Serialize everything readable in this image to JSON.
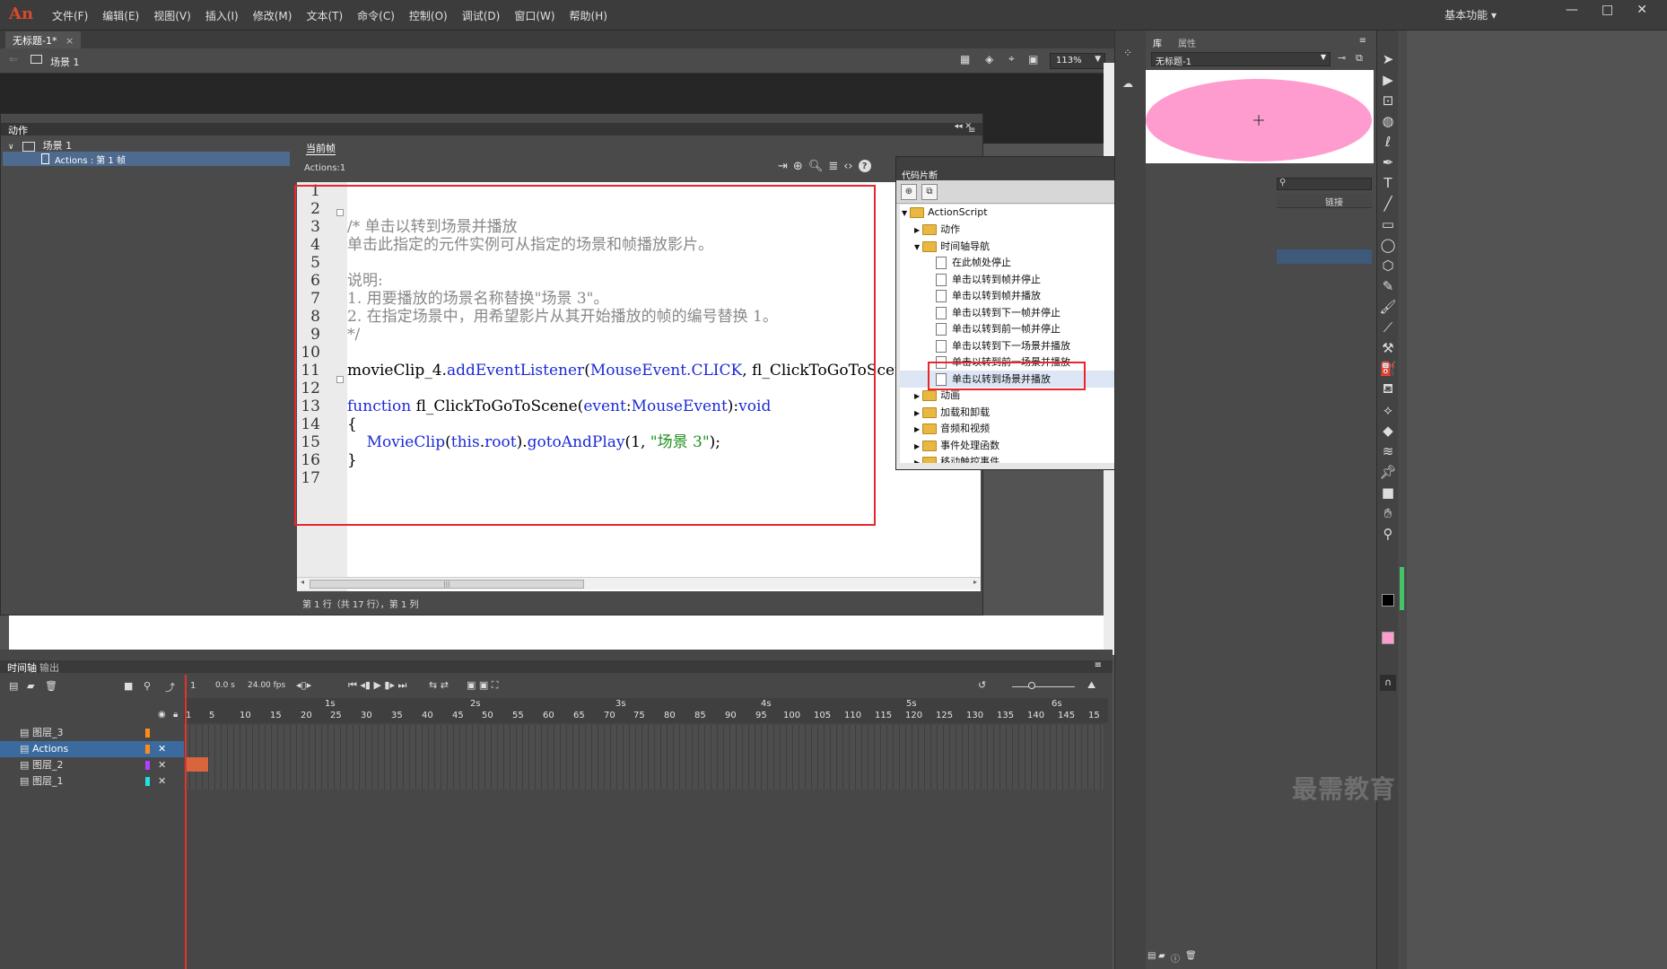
{
  "menubar": {
    "logo": "An",
    "items": [
      "文件(F)",
      "编辑(E)",
      "视图(V)",
      "插入(I)",
      "修改(M)",
      "文本(T)",
      "命令(C)",
      "控制(O)",
      "调试(D)",
      "窗口(W)",
      "帮助(H)"
    ],
    "workspace": "基本功能 ▾",
    "win_controls": [
      "—",
      "□",
      "✕"
    ]
  },
  "document": {
    "tab_label": "无标题-1*",
    "tab_close": "×",
    "scene_label": "场景 1",
    "zoom": "113%"
  },
  "actions_panel": {
    "title": "动作",
    "tree_scene": "场景 1",
    "tree_frame": "Actions : 第 1 帧",
    "tab_current": "当前帧",
    "script_name": "Actions:1",
    "line_numbers": [
      "1",
      "2",
      "3",
      "4",
      "5",
      "6",
      "7",
      "8",
      "9",
      "10",
      "11",
      "12",
      "13",
      "14",
      "15",
      "16",
      "17"
    ],
    "status": "第 1 行（共 17 行），第 1 列",
    "scroll_marker": "|||"
  },
  "code": {
    "line3": "/* 单击以转到场景并播放",
    "line4": "单击此指定的元件实例可从指定的场景和帧播放影片。",
    "line6": "说明:",
    "line7": "1. 用要播放的场景名称替换\"场景 3\"。",
    "line8": "2. 在指定场景中，用希望影片从其开始播放的帧的编号替换 1。",
    "line9": "*/",
    "line11_a": "movieClip_4.",
    "line11_b": "addEventListener",
    "line11_c": "(",
    "line11_d": "MouseEvent.CLICK",
    "line11_e": ", fl_ClickToGoToScene);",
    "line13_a": "function",
    "line13_b": " fl_ClickToGoToScene(",
    "line13_c": "event",
    "line13_d": ":",
    "line13_e": "MouseEvent",
    "line13_f": "):",
    "line13_g": "void",
    "line14": "{",
    "line15_a": "    MovieClip",
    "line15_b": "(",
    "line15_c": "this",
    "line15_d": ".",
    "line15_e": "root",
    "line15_f": ").",
    "line15_g": "gotoAndPlay",
    "line15_h": "(1, ",
    "line15_i": "\"场景 3\"",
    "line15_j": ");",
    "line16": "}"
  },
  "snippets_panel": {
    "title": "代码片断",
    "root": "ActionScript",
    "items": [
      {
        "label": "动作",
        "type": "folder",
        "level": 1,
        "expanded": false
      },
      {
        "label": "时间轴导航",
        "type": "folder",
        "level": 1,
        "expanded": true
      },
      {
        "label": "在此帧处停止",
        "type": "doc",
        "level": 2
      },
      {
        "label": "单击以转到帧并停止",
        "type": "doc",
        "level": 2
      },
      {
        "label": "单击以转到帧并播放",
        "type": "doc",
        "level": 2
      },
      {
        "label": "单击以转到下一帧并停止",
        "type": "doc",
        "level": 2
      },
      {
        "label": "单击以转到前一帧并停止",
        "type": "doc",
        "level": 2
      },
      {
        "label": "单击以转到下一场景并播放",
        "type": "doc",
        "level": 2
      },
      {
        "label": "单击以转到前一场景并播放",
        "type": "doc",
        "level": 2
      },
      {
        "label": "单击以转到场景并播放",
        "type": "doc",
        "level": 2,
        "selected": true
      },
      {
        "label": "动画",
        "type": "folder",
        "level": 1,
        "expanded": false
      },
      {
        "label": "加载和卸载",
        "type": "folder",
        "level": 1,
        "expanded": false
      },
      {
        "label": "音频和视频",
        "type": "folder",
        "level": 1,
        "expanded": false
      },
      {
        "label": "事件处理函数",
        "type": "folder",
        "level": 1,
        "expanded": false
      },
      {
        "label": "移动触控事件",
        "type": "folder",
        "level": 1,
        "expanded": false
      }
    ]
  },
  "library": {
    "tab_library": "库",
    "tab_properties": "属性",
    "doc_select": "无标题-1",
    "col_linkage": "链接",
    "preview_color": "#ff9ccf"
  },
  "timeline": {
    "tab_timeline": "时间轴",
    "tab_output": "输出",
    "frame": "1",
    "time": "0.0 s",
    "fps": "24.00 fps",
    "seconds": [
      "1s",
      "2s",
      "3s",
      "4s",
      "5s",
      "6s"
    ],
    "ticks": [
      "1",
      "5",
      "10",
      "15",
      "20",
      "25",
      "30",
      "35",
      "40",
      "45",
      "50",
      "55",
      "60",
      "65",
      "70",
      "75",
      "80",
      "85",
      "90",
      "95",
      "100",
      "105",
      "110",
      "115",
      "120",
      "125",
      "130",
      "135",
      "140",
      "145",
      "15"
    ],
    "layers": [
      {
        "name": "图层_3",
        "color": "#ff8c1a",
        "selected": false
      },
      {
        "name": "Actions",
        "color": "#ff8c1a",
        "selected": true
      },
      {
        "name": "图层_2",
        "color": "#b040ff",
        "selected": false
      },
      {
        "name": "图层_1",
        "color": "#22e0e0",
        "selected": false
      }
    ]
  },
  "watermark": "最需教育"
}
